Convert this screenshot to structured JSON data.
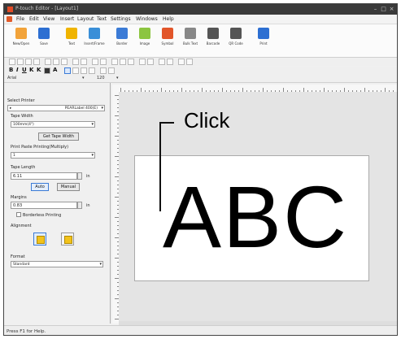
{
  "window": {
    "title": "P-touch Editor - [Layout1]"
  },
  "menu": [
    "File",
    "Edit",
    "View",
    "Insert",
    "Layout",
    "Text",
    "Settings",
    "Windows",
    "Help"
  ],
  "ribbon": {
    "buttons": [
      {
        "label": "New/Open",
        "icon": "new-open-icon",
        "color": "#f2a33a"
      },
      {
        "label": "Save",
        "icon": "save-icon",
        "color": "#2d6fd2"
      },
      {
        "label": "Text",
        "icon": "text-icon",
        "color": "#f0b400"
      },
      {
        "label": "Insert/Frame",
        "icon": "insert-frame-icon",
        "color": "#3a8fd8"
      },
      {
        "label": "Border",
        "icon": "border-icon",
        "color": "#3b7bd6"
      },
      {
        "label": "Image",
        "icon": "image-icon",
        "color": "#8cc540"
      },
      {
        "label": "Symbol",
        "icon": "symbol-icon",
        "color": "#e2562a"
      },
      {
        "label": "Bulk Text",
        "icon": "bulk-text-icon",
        "color": "#888888"
      },
      {
        "label": "Barcode",
        "icon": "barcode-icon",
        "color": "#555555"
      },
      {
        "label": "QR Code",
        "icon": "qr-code-icon",
        "color": "#555555"
      },
      {
        "label": "Print",
        "icon": "print-icon",
        "color": "#2d6fd2"
      }
    ]
  },
  "fontbar": {
    "font": "Arial",
    "size": "120"
  },
  "panel": {
    "printer_title": "Select Printer",
    "printer_value": "PEARLabel 400(E)",
    "tape_width_label": "Tape Width",
    "tape_width_value": "100mm(4\")",
    "get_tape_width": "Get Tape Width",
    "print_paste_label": "Print Paste Printing(Multiply)",
    "print_paste_value": "1",
    "tape_length_label": "Tape Length",
    "tape_length_value": "6.11",
    "tape_length_unit": "in",
    "auto_label": "Auto",
    "manual_label": "Manual",
    "margins_label": "Margins",
    "margins_value": "0.83",
    "margins_unit": "in",
    "borderless_label": "Borderless Printing",
    "alignment_label": "Alignment",
    "format_label": "Format",
    "format_value": "Standard"
  },
  "canvas": {
    "text": "ABC",
    "callout": "Click"
  },
  "status": "Press F1 for Help."
}
